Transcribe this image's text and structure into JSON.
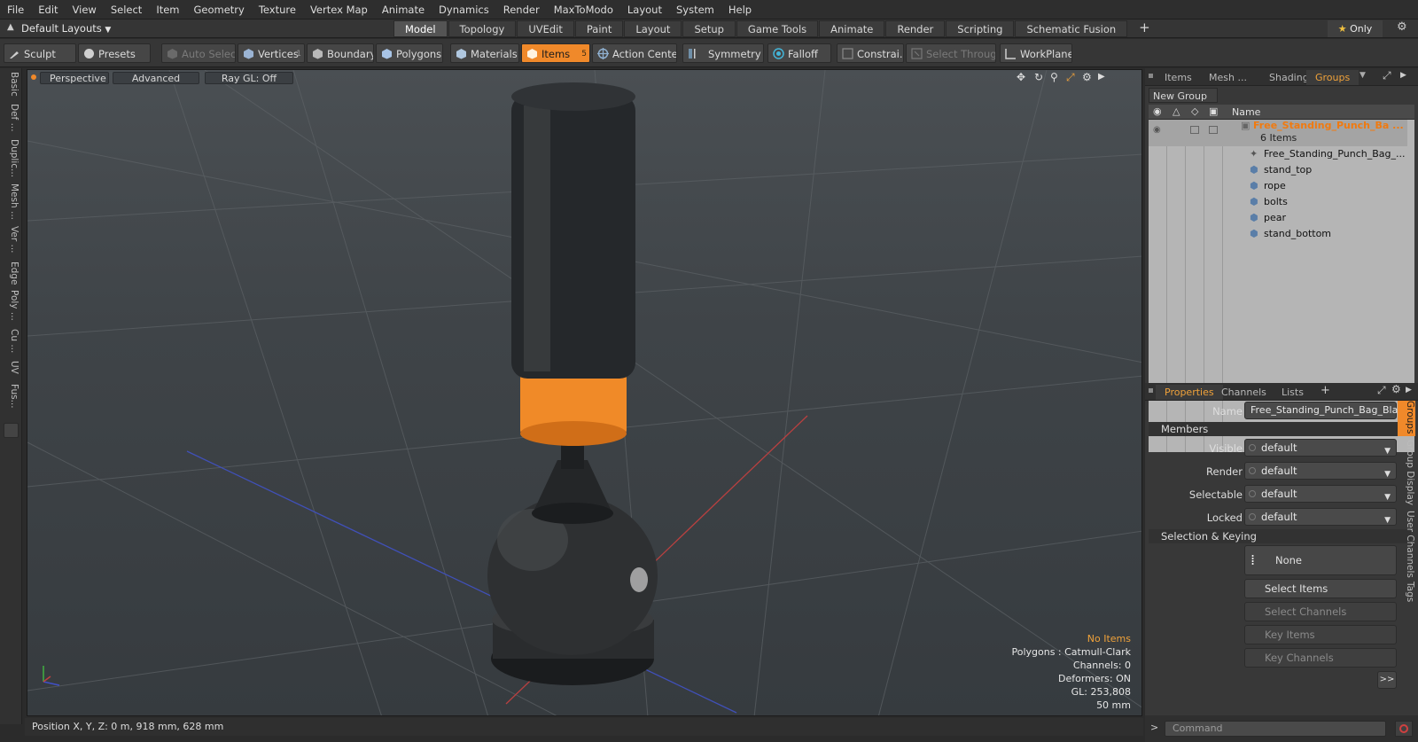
{
  "menu": [
    "File",
    "Edit",
    "View",
    "Select",
    "Item",
    "Geometry",
    "Texture",
    "Vertex Map",
    "Animate",
    "Dynamics",
    "Render",
    "MaxToModo",
    "Layout",
    "System",
    "Help"
  ],
  "layouts": {
    "label": "Default Layouts"
  },
  "tabs": [
    {
      "label": "Model",
      "active": true
    },
    {
      "label": "Topology"
    },
    {
      "label": "UVEdit"
    },
    {
      "label": "Paint"
    },
    {
      "label": "Layout"
    },
    {
      "label": "Setup"
    },
    {
      "label": "Game Tools"
    },
    {
      "label": "Animate"
    },
    {
      "label": "Render"
    },
    {
      "label": "Scripting"
    },
    {
      "label": "Schematic Fusion"
    }
  ],
  "only_label": "Only",
  "toolbar": {
    "sculpt": "Sculpt",
    "presets": "Presets",
    "auto_select": "Auto Select",
    "vertices": "Vertices",
    "vertices_count": "1",
    "boundary": "Boundary",
    "polygons": "Polygons",
    "materials": "Materials",
    "items": "Items",
    "items_count": "5",
    "action_center": "Action Center",
    "symmetry": "Symmetry",
    "falloff": "Falloff",
    "constraints": "Constrai...",
    "select_through": "Select Through",
    "workplane": "WorkPlane"
  },
  "left_tabs": [
    "Basic",
    "Def ...",
    "Duplic...",
    "Mesh ...",
    "Ver ...",
    "Edge",
    "Poly ...",
    "Cu ...",
    "UV",
    "Fus..."
  ],
  "viewport": {
    "view": "Perspective",
    "advanced": "Advanced",
    "raygl": "Ray GL: Off",
    "info": {
      "selection": "No Items",
      "polygons": "Polygons : Catmull-Clark",
      "channels": "Channels: 0",
      "deformers": "Deformers: ON",
      "gl": "GL: 253,808",
      "scale": "50 mm"
    }
  },
  "status": {
    "position": "Position X, Y, Z:  0 m, 918 mm, 628 mm"
  },
  "top_panel": {
    "tabs": [
      "Items",
      "Mesh ...",
      "Shading",
      "Groups"
    ],
    "active_tab": "Groups",
    "new_group": "New Group",
    "col_name": "Name",
    "group": {
      "name": "Free_Standing_Punch_Ba ...",
      "count": "6 Items"
    },
    "members": [
      "Free_Standing_Punch_Bag_...",
      "stand_top",
      "rope",
      "bolts",
      "pear",
      "stand_bottom"
    ]
  },
  "props": {
    "tabs": [
      "Properties",
      "Channels",
      "Lists"
    ],
    "name_label": "Name",
    "name_value": "Free_Standing_Punch_Bag_Black",
    "members_section": "Members",
    "rows": [
      {
        "label": "Visible",
        "value": "default"
      },
      {
        "label": "Render",
        "value": "default"
      },
      {
        "label": "Selectable",
        "value": "default"
      },
      {
        "label": "Locked",
        "value": "default"
      }
    ],
    "sel_section": "Selection & Keying",
    "none_btn": "None",
    "select_items": "Select Items",
    "select_channels": "Select Channels",
    "key_items": "Key Items",
    "key_channels": "Key Channels",
    "more": ">>",
    "side_tabs": [
      "Groups",
      "Group Display",
      "User Channels",
      "Tags"
    ]
  },
  "command": {
    "placeholder": "Command"
  },
  "colors": {
    "accent": "#f0892a",
    "accent_text": "#f0a23a",
    "list_bg": "#b5b5b5"
  }
}
